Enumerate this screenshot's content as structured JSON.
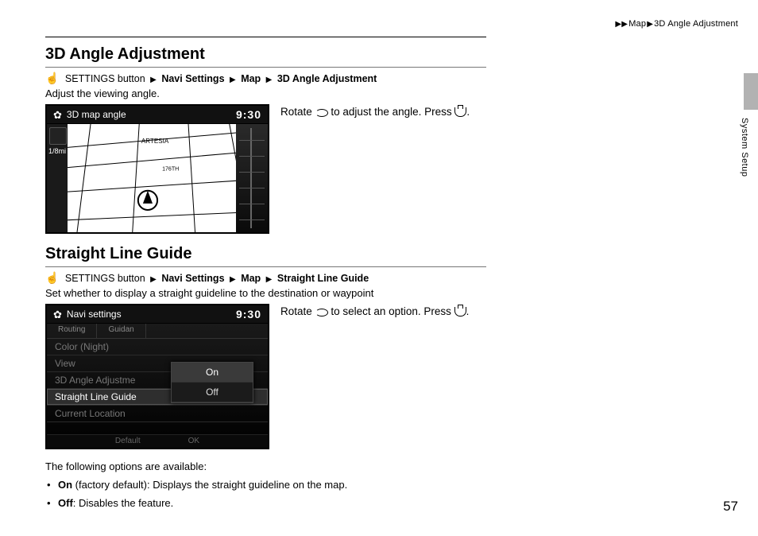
{
  "header": {
    "crumb_arrows": "▶▶",
    "crumb_map": "Map",
    "crumb_sep": "▶",
    "crumb_page": "3D Angle Adjustment"
  },
  "side": {
    "section_label": "System Setup"
  },
  "section1": {
    "title": "3D Angle Adjustment",
    "path_prefix": "SETTINGS button",
    "path_navi": "Navi Settings",
    "path_map": "Map",
    "path_leaf": "3D Angle Adjustment",
    "lead": "Adjust the viewing angle.",
    "instr_a": "Rotate",
    "instr_b": "to adjust the angle. Press",
    "instr_c": "."
  },
  "screenshot1": {
    "title": "3D map angle",
    "clock": "9:30",
    "scale": "1/8mi",
    "label_a": "ARTESIA",
    "label_b": "176TH"
  },
  "section2": {
    "title": "Straight Line Guide",
    "path_prefix": "SETTINGS button",
    "path_navi": "Navi Settings",
    "path_map": "Map",
    "path_leaf": "Straight Line Guide",
    "lead": "Set whether to display a straight guideline to the destination or waypoint",
    "instr_a": "Rotate",
    "instr_b": "to select an option. Press",
    "instr_c": "."
  },
  "screenshot2": {
    "title": "Navi settings",
    "clock": "9:30",
    "tab1": "Routing",
    "tab2": "Guidan",
    "row1": "Color (Night)",
    "row2": "View",
    "row3": "3D Angle Adjustme",
    "row4": "Straight Line Guide",
    "row5": "Current Location",
    "popup_on": "On",
    "popup_off": "Off",
    "foot_l": "Default",
    "foot_r": "OK"
  },
  "options": {
    "intro": "The following options are available:",
    "on_label": "On",
    "on_text": " (factory default): Displays the straight guideline on the map.",
    "off_label": "Off",
    "off_text": ": Disables the feature."
  },
  "page_number": "57"
}
